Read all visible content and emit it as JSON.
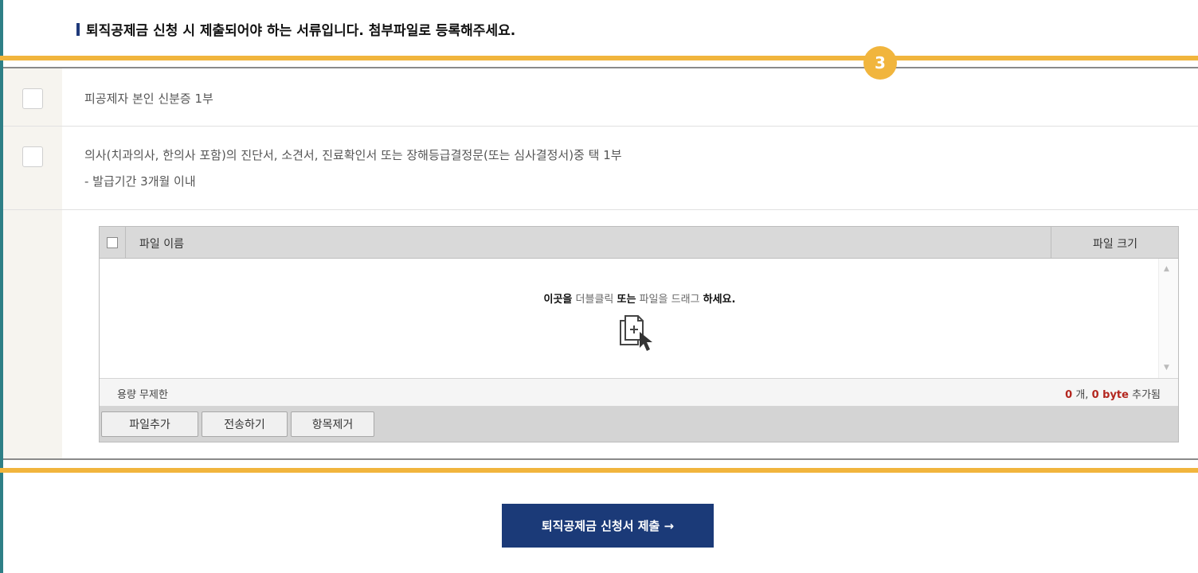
{
  "notice": {
    "text": "퇴직공제금 신청 시 제출되어야 하는 서류입니다. 첨부파일로 등록해주세요."
  },
  "step_badge": "3",
  "documents": [
    {
      "line1": "피공제자 본인 신분증 1부"
    },
    {
      "line1": "의사(치과의사, 한의사 포함)의 진단서, 소견서, 진료확인서 또는 장해등급결정문(또는 심사결정서)중 택 1부",
      "line2": "- 발급기간 3개월 이내"
    }
  ],
  "uploader": {
    "col_name": "파일 이름",
    "col_size": "파일 크기",
    "drop": {
      "part1": "이곳을",
      "part2": "더블클릭",
      "part3": "또는",
      "part4": "파일을 드래그",
      "part5": "하세요."
    },
    "capacity": "용량 무제한",
    "count": "0",
    "count_unit": "개,",
    "bytes": "0 byte",
    "added": "추가됨",
    "buttons": {
      "add": "파일추가",
      "send": "전송하기",
      "remove": "항목제거"
    }
  },
  "submit": {
    "label": "퇴직공제금 신청서 제출 →"
  },
  "colors": {
    "accent": "#f1b53d",
    "primary": "#1b3a78",
    "teal": "#2e7f86",
    "count_red": "#b3261e"
  }
}
